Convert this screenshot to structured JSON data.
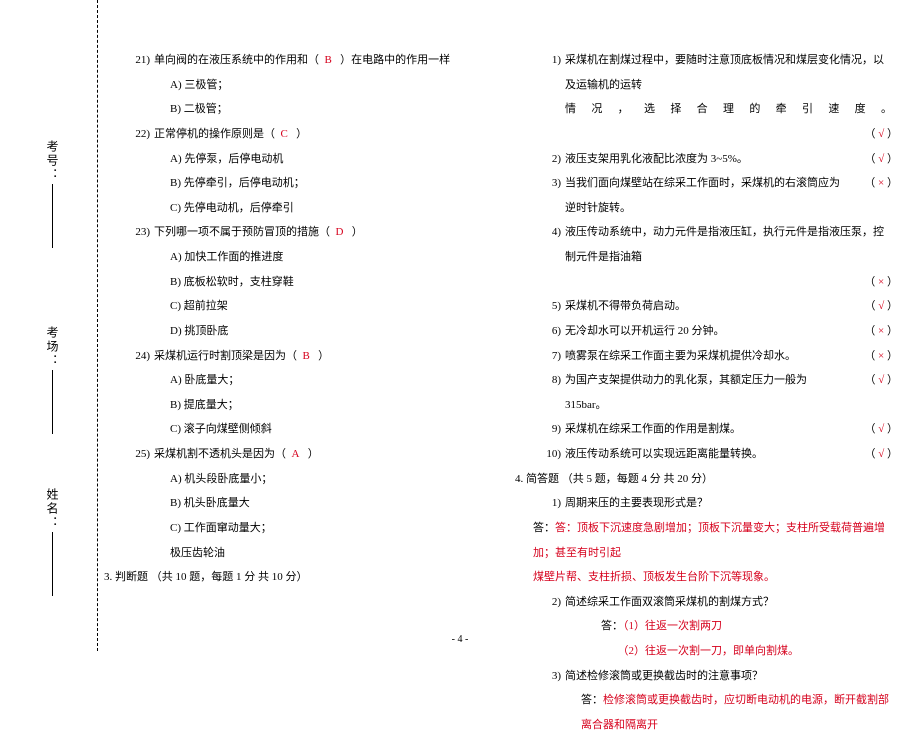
{
  "labels": {
    "exam_no": "考号：",
    "room": "考场：",
    "name": "姓名："
  },
  "left": {
    "q21": {
      "num": "21)",
      "text_a": "单向阀的在液压系统中的作用和（",
      "ans": "B",
      "text_b": "）在电路中的作用一样",
      "opts": {
        "A": "A)  三极管；",
        "B": "B)  二极管；"
      }
    },
    "q22": {
      "num": "22)",
      "text_a": "正常停机的操作原则是（",
      "ans": "C",
      "text_b": "）",
      "opts": {
        "A": "A)  先停泵，后停电动机",
        "B": "B)  先停牵引，后停电动机；",
        "C": "C)  先停电动机，后停牵引"
      }
    },
    "q23": {
      "num": "23)",
      "text_a": "下列哪一项不属于预防冒顶的措施（",
      "ans": "D",
      "text_b": "）",
      "opts": {
        "A": "A)  加快工作面的推进度",
        "B": "B)  底板松软时，支柱穿鞋",
        "C": "C)  超前拉架",
        "D": "D)  挑顶卧底"
      }
    },
    "q24": {
      "num": "24)",
      "text_a": "采煤机运行时割顶梁是因为（",
      "ans": "B",
      "text_b": "）",
      "opts": {
        "A": "A)  卧底量大；",
        "B": "B)  提底量大；",
        "C": "C)  滚子向煤壁侧倾斜"
      }
    },
    "q25": {
      "num": "25)",
      "text_a": "采煤机割不透机头是因为（",
      "ans": "A",
      "text_b": "）",
      "opts": {
        "A": "A)  机头段卧底量小；",
        "B": "B)  机头卧底量大",
        "C": "C)  工作面窜动量大；"
      }
    },
    "extra": "极压齿轮油",
    "section3": "3.    判断题  （共 10 题，每题 1 分  共 10 分）"
  },
  "right": {
    "tf": {
      "i1": {
        "num": "1)",
        "text": "采煤机在割煤过程中，要随时注意顶底板情况和煤层变化情况，以及运输机的运转",
        "line2": "情况，选择合理的牵引速度。",
        "mark": "（ √  ）",
        "mark_true": true
      },
      "i2": {
        "num": "2)",
        "text": "液压支架用乳化液配比浓度为 3~5%。",
        "mark": "（ √  ）",
        "mark_true": true
      },
      "i3": {
        "num": "3)",
        "text": "当我们面向煤壁站在综采工作面时，采煤机的右滚筒应为逆时针旋转。",
        "mark": "（  ×  ）",
        "mark_true": false
      },
      "i4": {
        "num": "4)",
        "text": "液压传动系统中，动力元件是指液压缸，执行元件是指液压泵，控制元件是指油箱",
        "mark": "（  × ）",
        "mark_true": false
      },
      "i5": {
        "num": "5)",
        "text": "采煤机不得带负荷启动。",
        "mark": "（ √  ）",
        "mark_true": true
      },
      "i6": {
        "num": "6)",
        "text": "无冷却水可以开机运行 20 分钟。",
        "mark": "（  ×  ）",
        "mark_true": false
      },
      "i7": {
        "num": "7)",
        "text": "喷雾泵在综采工作面主要为采煤机提供冷却水。",
        "mark": "（  ×  ）",
        "mark_true": false
      },
      "i8": {
        "num": "8)",
        "text": "为国产支架提供动力的乳化泵，其额定压力一般为 315bar。",
        "mark": "（ √  ）",
        "mark_true": true
      },
      "i9": {
        "num": "9)",
        "text": "采煤机在综采工作面的作用是割煤。",
        "mark": "（ √  ）",
        "mark_true": true
      },
      "i10": {
        "num": "10)",
        "text": "液压传动系统可以实现远距离能量转换。",
        "mark": "（ √  ）",
        "mark_true": true
      }
    },
    "section4": "4.    简答题  （共 5 题，每题 4 分  共 20 分）",
    "sa": {
      "q1": {
        "num": "1)",
        "text": "周期来压的主要表现形式是？"
      },
      "a1a": "答：顶板下沉速度急剧增加；顶板下沉量变大；支柱所受载荷普遍增加；甚至有时引起",
      "a1b": "煤壁片帮、支柱折损、顶板发生台阶下沉等现象。",
      "q2": {
        "num": "2)",
        "text": "简述综采工作面双滚筒采煤机的割煤方式？"
      },
      "a2_label": "答：",
      "a2a": "（1）往返一次割两刀",
      "a2b": "（2）往返一次割一刀，即单向割煤。",
      "q3": {
        "num": "3)",
        "text": "简述检修滚筒或更换截齿时的注意事项？"
      },
      "a3_label": "答：",
      "a3": "检修滚筒或更换截齿时，应切断电动机的电源，断开截割部离合器和隔离开"
    }
  },
  "footer": "- 4 -"
}
